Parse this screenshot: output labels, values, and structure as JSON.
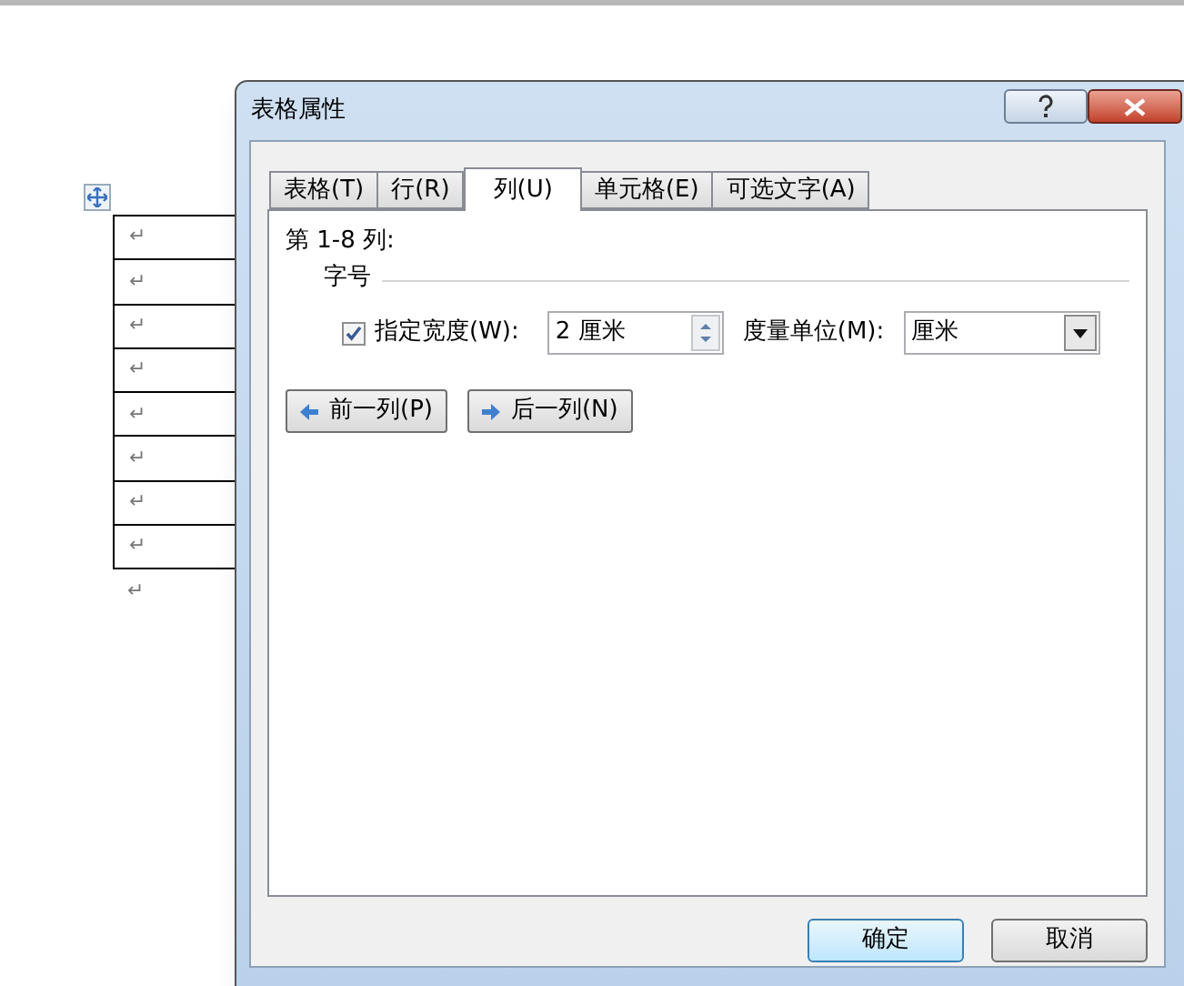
{
  "document": {
    "table_rows": [
      {
        "mark": "↵"
      },
      {
        "mark": "↵"
      },
      {
        "mark": "↵"
      },
      {
        "mark": "↵"
      },
      {
        "mark": "↵"
      },
      {
        "mark": "↵"
      },
      {
        "mark": "↵"
      },
      {
        "mark": "↵"
      }
    ],
    "trailing_mark": "↵"
  },
  "dialog": {
    "title": "表格属性",
    "tabs": [
      {
        "label": "表格(T)",
        "selected": false
      },
      {
        "label": "行(R)",
        "selected": false
      },
      {
        "label": "列(U)",
        "selected": true
      },
      {
        "label": "单元格(E)",
        "selected": false
      },
      {
        "label": "可选文字(A)",
        "selected": false
      }
    ],
    "column_range": "第 1-8 列:",
    "group_label": "字号",
    "width_checkbox": {
      "label": "指定宽度(W):",
      "checked": true
    },
    "width_value": "2 厘米",
    "unit_label": "度量单位(M):",
    "unit_value": "厘米",
    "prev_button": "前一列(P)",
    "next_button": "后一列(N)",
    "ok_button": "确定",
    "cancel_button": "取消"
  }
}
